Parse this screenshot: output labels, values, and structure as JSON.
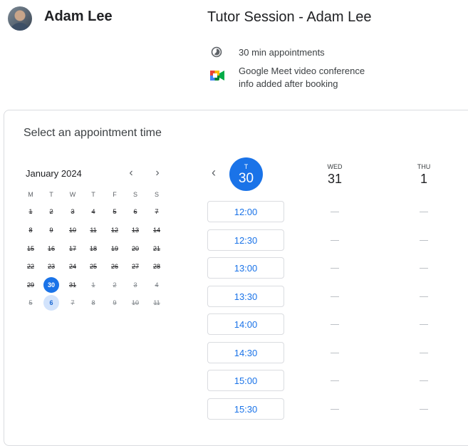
{
  "header": {
    "host_name": "Adam Lee",
    "event_title": "Tutor Session - Adam Lee",
    "duration": "30 min appointments",
    "conference_line1": "Google Meet video conference",
    "conference_line2": "info added after booking"
  },
  "card": {
    "heading": "Select an appointment time"
  },
  "mini_calendar": {
    "month": "January 2024",
    "weekdays": [
      "M",
      "T",
      "W",
      "T",
      "F",
      "S",
      "S"
    ],
    "rows": [
      [
        "1",
        "2",
        "3",
        "4",
        "5",
        "6",
        "7"
      ],
      [
        "8",
        "9",
        "10",
        "11",
        "12",
        "13",
        "14"
      ],
      [
        "15",
        "16",
        "17",
        "18",
        "19",
        "20",
        "21"
      ],
      [
        "22",
        "23",
        "24",
        "25",
        "26",
        "27",
        "28"
      ],
      [
        "29",
        "30",
        "31",
        "1",
        "2",
        "3",
        "4"
      ],
      [
        "5",
        "6",
        "7",
        "8",
        "9",
        "10",
        "11"
      ]
    ],
    "selected": "30",
    "available": "6"
  },
  "week": {
    "columns": [
      {
        "dow": "T",
        "date": "30"
      },
      {
        "dow": "WED",
        "date": "31"
      },
      {
        "dow": "THU",
        "date": "1"
      }
    ],
    "slots": [
      "12:00",
      "12:30",
      "13:00",
      "13:30",
      "14:00",
      "14:30",
      "15:00",
      "15:30"
    ],
    "unavailable_mark": "—"
  },
  "colors": {
    "accent": "#1a73e8",
    "available_bg": "#d2e3fc",
    "border": "#dadce0"
  }
}
